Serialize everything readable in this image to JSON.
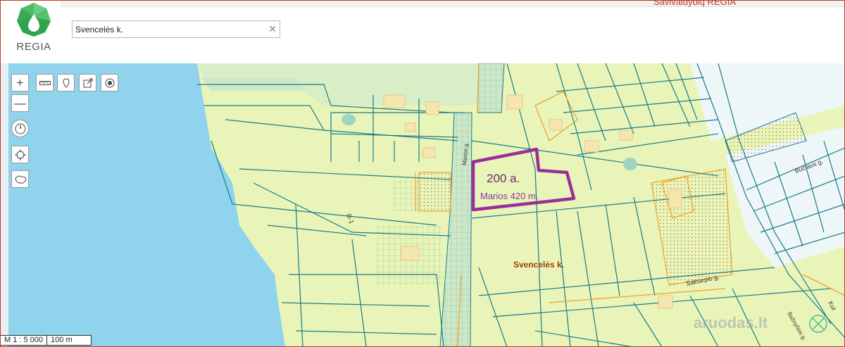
{
  "header": {
    "logo_text": "REGIA",
    "top_brand": "Savivaldybių REGIA",
    "search": {
      "value": "Svencelės k.",
      "clear_icon": "close-icon"
    }
  },
  "map": {
    "labels": {
      "plot_area": "200 a.",
      "plot_distance": "Marios 420 m.",
      "village": "Svencelės k.",
      "street_buciaus": "Bučiaus g.",
      "street_saktarpio": "Saktarpio g.",
      "road_d": "D-1",
      "street_kur": "Kur",
      "street_lower": "Bažnyčios g.",
      "road_vertical": "Marios g."
    },
    "colors": {
      "water": "#8fd3ec",
      "land": "#e9f5b8",
      "plot_highlight": "#9b2e9b",
      "parcel_line": "#1a7a8a",
      "orange_line": "#f0a030"
    }
  },
  "tools": {
    "zoom_in": "+",
    "zoom_out": "—",
    "icons": [
      "ruler-icon",
      "marker-icon",
      "export-icon",
      "target-icon",
      "clock-icon",
      "locate-icon",
      "lithuania-outline-icon"
    ]
  },
  "scale": {
    "ratio": "M 1 : 5 000",
    "bar": "100 m"
  },
  "watermark": "aruodas.lt"
}
